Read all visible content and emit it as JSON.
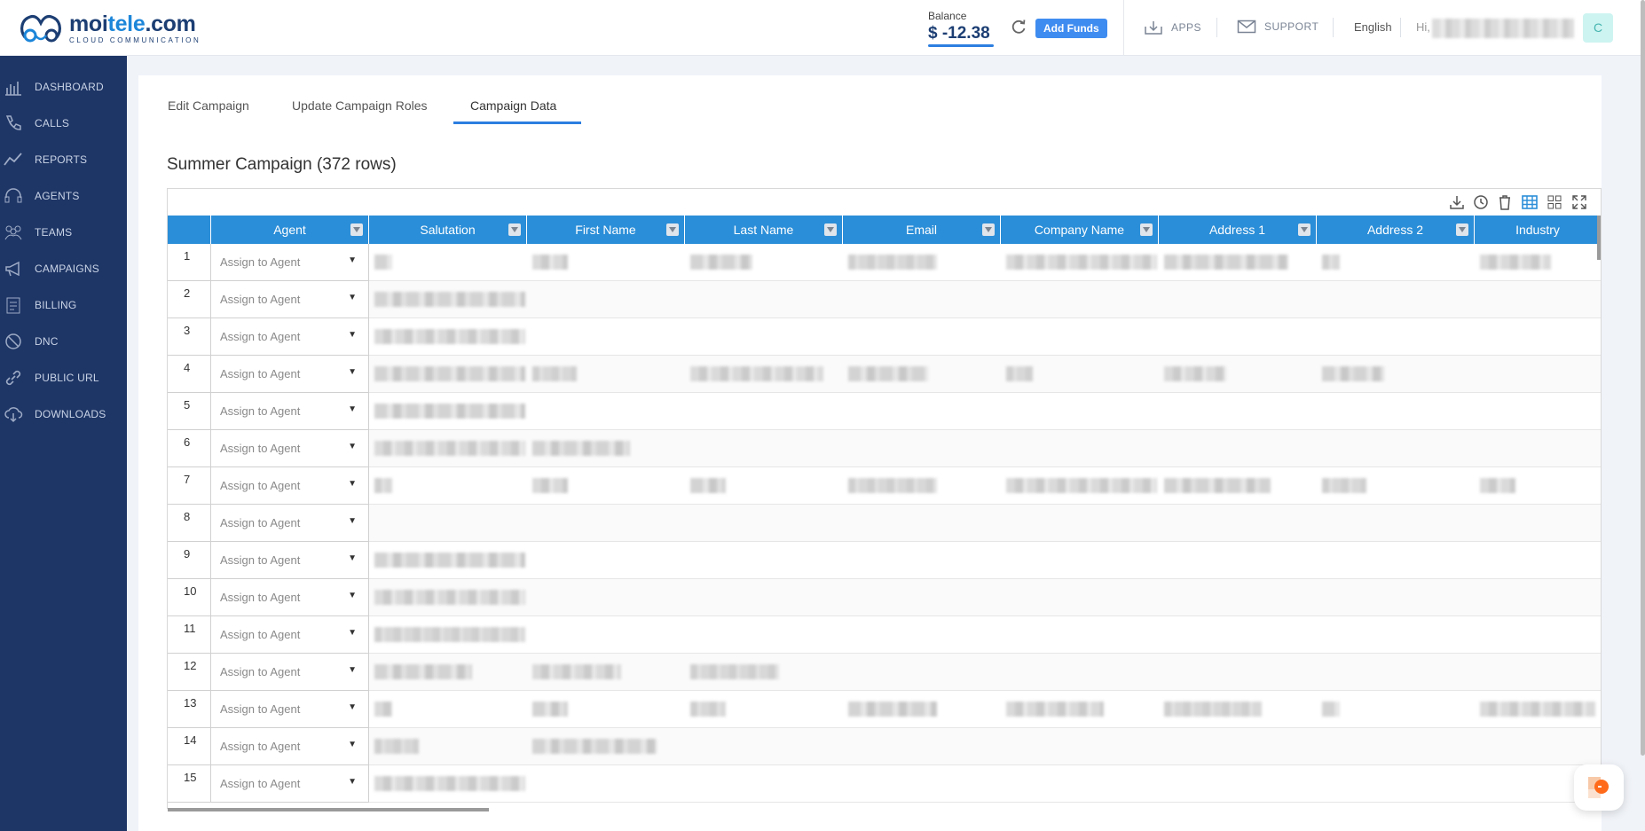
{
  "brand": {
    "name_part1": "moi",
    "name_part2": "tele",
    "name_part3": ".com",
    "subtitle": "CLOUD COMMUNICATION"
  },
  "header": {
    "balance_label": "Balance",
    "balance_value": "$ -12.38",
    "add_funds_label": "Add Funds",
    "apps_label": "APPS",
    "support_label": "SUPPORT",
    "language": "English",
    "greeting": "Hi,",
    "avatar_initial": "C"
  },
  "sidebar": {
    "items": [
      {
        "label": "DASHBOARD",
        "icon": "dashboard-icon"
      },
      {
        "label": "CALLS",
        "icon": "phone-icon"
      },
      {
        "label": "REPORTS",
        "icon": "reports-icon"
      },
      {
        "label": "AGENTS",
        "icon": "headset-icon"
      },
      {
        "label": "TEAMS",
        "icon": "teams-icon"
      },
      {
        "label": "CAMPAIGNS",
        "icon": "megaphone-icon"
      },
      {
        "label": "BILLING",
        "icon": "billing-icon"
      },
      {
        "label": "DNC",
        "icon": "block-icon"
      },
      {
        "label": "PUBLIC URL",
        "icon": "link-icon"
      },
      {
        "label": "DOWNLOADS",
        "icon": "cloud-download-icon"
      }
    ]
  },
  "tabs": [
    {
      "label": "Edit Campaign"
    },
    {
      "label": "Update Campaign Roles"
    },
    {
      "label": "Campaign Data",
      "active": true
    }
  ],
  "page_title": "Summer Campaign (372 rows)",
  "toolbar": {
    "icons": [
      "download-icon",
      "history-icon",
      "trash-icon",
      "table-view-icon",
      "grid-view-icon",
      "fullscreen-icon"
    ]
  },
  "table": {
    "columns": [
      "Agent",
      "Salutation",
      "First Name",
      "Last Name",
      "Email",
      "Company Name",
      "Address 1",
      "Address 2",
      "Industry"
    ],
    "agent_placeholder": "Assign to Agent",
    "row_numbers": [
      "1",
      "2",
      "3",
      "4",
      "5",
      "6",
      "7",
      "8",
      "9",
      "10",
      "11",
      "12",
      "13",
      "14",
      "15"
    ]
  },
  "colors": {
    "sidebar": "#1e3666",
    "header_row": "#2b8ed8",
    "accent": "#2c7ee0",
    "add_funds": "#3f8cf0"
  }
}
